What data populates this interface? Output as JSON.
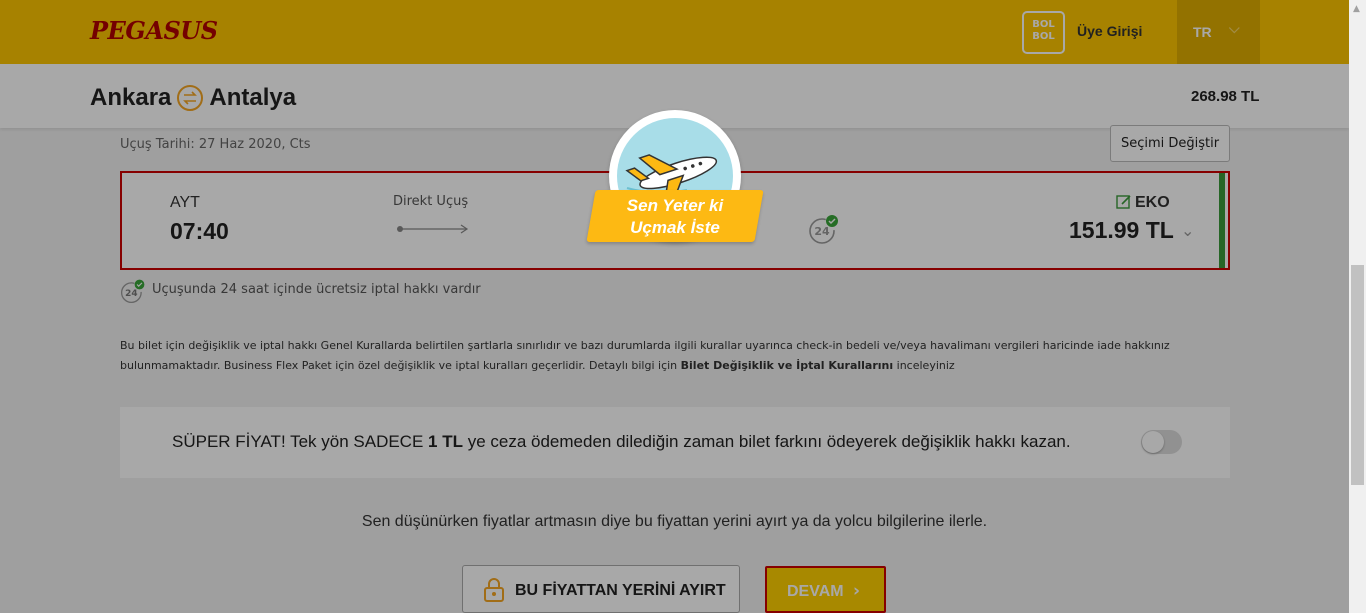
{
  "brand": {
    "logo_text": "PEGASUS",
    "bolbol_text": "BOL BOL",
    "login_label": "Üye Girişi",
    "language": "TR",
    "primary_color": "#fdc500",
    "accent_red": "#b00000"
  },
  "route": {
    "origin": "Ankara",
    "destination": "Antalya",
    "total_price": "268.98 TL"
  },
  "flight": {
    "date_label": "Uçuş Tarihi: 27 Haz 2020, Cts",
    "change_button": "Seçimi Değiştir",
    "departure_code": "AYT",
    "departure_time": "07:40",
    "flight_type": "Direkt Uçuş",
    "fare_class": "EKO",
    "fare_price": "151.99 TL",
    "free_cancel_note": "Uçuşunda 24 saat içinde ücretsiz iptal hakkı vardır"
  },
  "rules": {
    "text_1": "Bu bilet için değişiklik ve iptal hakkı Genel Kurallarda belirtilen şartlarla sınırlıdır ve bazı durumlarda ilgili kurallar uyarınca check-in bedeli ve/veya havalimanı vergileri haricinde iade hakkınız bulunmamaktadır. Business Flex Paket için özel değişiklik ve iptal kuralları geçerlidir. Detaylı bilgi için ",
    "link_text": "Bilet Değişiklik ve İptal Kurallarını",
    "text_2": " inceleyiniz"
  },
  "super_price": {
    "prefix": "SÜPER FİYAT! Tek yön SADECE ",
    "amount": "1 TL",
    "suffix": " ye ceza ödemeden dilediğin zaman bilet farkını ödeyerek değişiklik hakkı kazan.",
    "toggle_on": false
  },
  "cta": {
    "hint": "Sen düşünürken fiyatlar artmasın diye bu fiyattan yerini ayırt ya da yolcu bilgilerine ilerle.",
    "reserve_label": "BU FİYATTAN YERİNİ AYIRT",
    "continue_label": "DEVAM"
  },
  "badge": {
    "line_1": "Sen Yeter ki",
    "line_2": "Uçmak İste"
  },
  "icons": {
    "swap": "swap-arrows-icon",
    "lock": "lock-icon",
    "edit": "edit-icon",
    "cancel24": "24h-cancel-icon"
  }
}
